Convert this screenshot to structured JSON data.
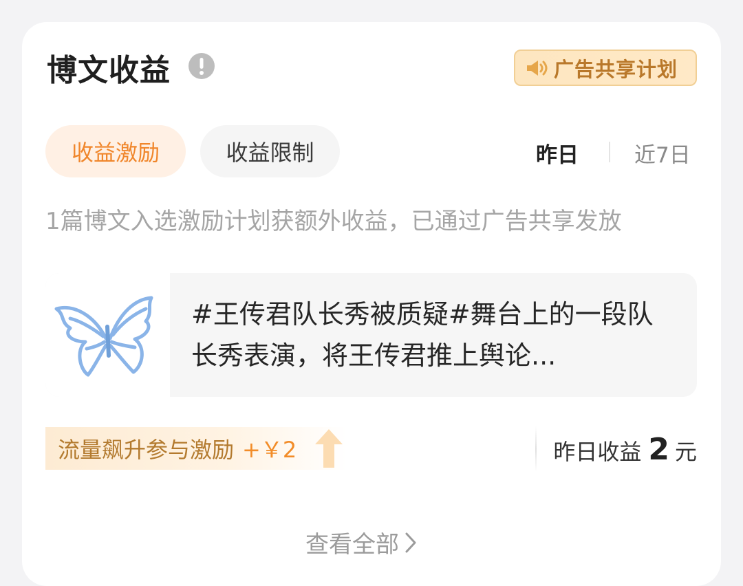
{
  "header": {
    "title": "博文收益",
    "info_icon": "exclamation-circle-icon",
    "badge_label": "广告共享计划",
    "badge_icon": "speaker-icon"
  },
  "tabs": [
    {
      "label": "收益激励",
      "active": true
    },
    {
      "label": "收益限制",
      "active": false
    }
  ],
  "range": {
    "yesterday": "昨日",
    "last7": "近7日",
    "selected": "昨日"
  },
  "description": "1篇博文入选激励计划获额外收益，已通过广告共享发放",
  "post": {
    "thumbnail_icon": "butterfly-icon",
    "text": "#王传君队长秀被质疑#舞台上的一段队长秀表演，将王传君推上舆论..."
  },
  "boost": {
    "text": "流量飙升参与激励",
    "amount": "+￥2",
    "icon": "arrow-up-icon"
  },
  "earnings": {
    "label": "昨日收益",
    "value": "2",
    "unit": "元"
  },
  "footer": {
    "view_all": "查看全部",
    "icon": "chevron-right-icon"
  },
  "colors": {
    "accent": "#f0862b",
    "badge_text": "#b9782a",
    "background": "#f3f3f5"
  }
}
